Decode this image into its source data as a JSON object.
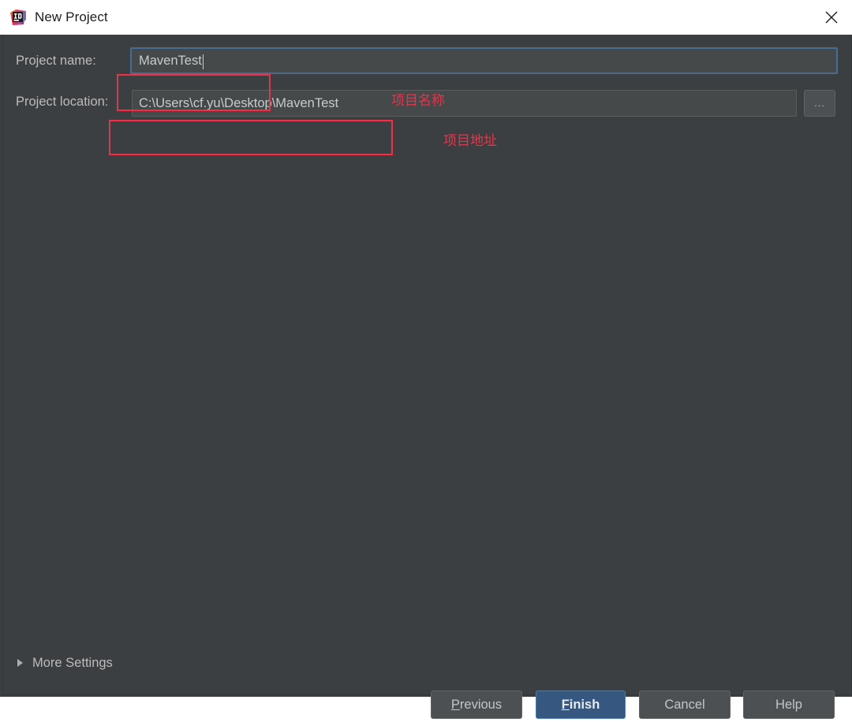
{
  "window": {
    "title": "New Project",
    "app_icon": "intellij-idea-icon",
    "close_icon": "close-icon",
    "background_color": "#3c3f41",
    "titlebar_color": "#ffffff"
  },
  "form": {
    "project_name": {
      "label": "Project name:",
      "value": "MavenTest",
      "focused": true,
      "focus_color": "#466d94"
    },
    "project_location": {
      "label": "Project location:",
      "value": "C:\\Users\\cf.yu\\Desktop\\MavenTest",
      "browse_label": "...",
      "browse_icon": "ellipsis-icon"
    }
  },
  "annotations": {
    "color": "#e8334a",
    "project_name_note": "项目名称",
    "project_location_note": "项目地址"
  },
  "more_settings": {
    "label": "More Settings",
    "expanded": false,
    "arrow_icon": "chevron-right-icon"
  },
  "footer": {
    "buttons": [
      {
        "label": "Previous",
        "mnemonic": "P",
        "rest": "revious",
        "primary": false
      },
      {
        "label": "Finish",
        "mnemonic": "F",
        "rest": "inish",
        "primary": true
      },
      {
        "label": "Cancel",
        "mnemonic": "",
        "rest": "Cancel",
        "primary": false
      },
      {
        "label": "Help",
        "mnemonic": "",
        "rest": "Help",
        "primary": false
      }
    ],
    "primary_color": "#365880"
  }
}
